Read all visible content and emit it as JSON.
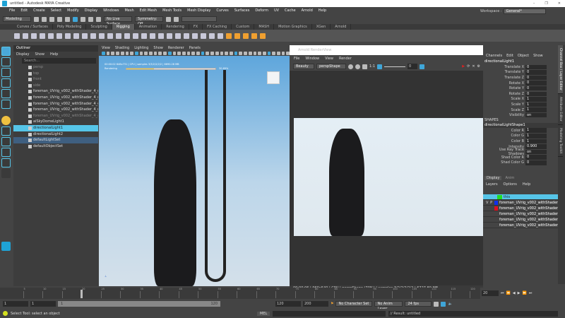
{
  "window": {
    "title": "untitled - Autodesk MAYA Creative",
    "controls": [
      "–",
      "❐",
      "✕"
    ]
  },
  "menubar": [
    "File",
    "Edit",
    "Create",
    "Select",
    "Modify",
    "Display",
    "Windows",
    "Mesh",
    "Edit Mesh",
    "Mesh Tools",
    "Mesh Display",
    "Curves",
    "Surfaces",
    "Deform",
    "UV",
    "Cache",
    "Arnold",
    "Help"
  ],
  "statusline": {
    "mode": "Modeling",
    "live_surface": "No Live Surface",
    "symmetry": "Symmetry: Off",
    "workspace_label": "Workspace :",
    "workspace": "General*"
  },
  "shelf": {
    "tabs": [
      "Curves / Surfaces",
      "Poly Modeling",
      "Sculpting",
      "Rigging",
      "Animation",
      "Rendering",
      "FX",
      "FX Caching",
      "Custom",
      "MASH",
      "Motion Graphics",
      "XGen",
      "Arnold"
    ],
    "active": "Rigging"
  },
  "outliner": {
    "title": "Outliner",
    "menu": [
      "Display",
      "Show",
      "Help"
    ],
    "search_placeholder": "Search...",
    "items": [
      {
        "label": "persp",
        "state": "dim"
      },
      {
        "label": "top",
        "state": "dim"
      },
      {
        "label": "front",
        "state": "dim"
      },
      {
        "label": "side",
        "state": "dim"
      },
      {
        "label": "foreman_UVrig_v002_withShader_4_mainGrp",
        "state": ""
      },
      {
        "label": "foreman_UVrig_v002_withShader_4_mdl",
        "state": ""
      },
      {
        "label": "foreman_UVrig_v002_withShader_4_ctrl",
        "state": ""
      },
      {
        "label": "foreman_UVrig_v002_withShader_4_rig",
        "state": ""
      },
      {
        "label": "foreman_UVrig_v002_withShader_4_aiSkyDomeLight",
        "state": "dim"
      },
      {
        "label": "aiSkyDomeLight1",
        "state": ""
      },
      {
        "label": "directionalLight1",
        "state": "sel"
      },
      {
        "label": "directionalLight2",
        "state": ""
      },
      {
        "label": "defaultLightSet",
        "state": "set"
      },
      {
        "label": "defaultObjectSet",
        "state": ""
      }
    ]
  },
  "viewport": {
    "menu": [
      "View",
      "Shading",
      "Lighting",
      "Show",
      "Renderer",
      "Panels"
    ],
    "render_info": "00:00:02 646x731 | CPU | samples 3/3/2/2/2/2 | 6690.28 MB",
    "progress_label": "Rendering",
    "progress_text": "30.69%",
    "progress": 0.3069
  },
  "renderview": {
    "title": "Arnold RenderView",
    "menu": [
      "File",
      "Window",
      "View",
      "Render"
    ],
    "aov": "Beauty",
    "camera": "perspShape",
    "ratio": "1:1",
    "exposure": "0",
    "status": "00:00:06 | 960x540 | CPU | perspShape (70%) | samples 3/2/2/2/2/2 | 6727.89 MB"
  },
  "channelbox": {
    "menu": [
      "Channels",
      "Edit",
      "Object",
      "Show"
    ],
    "node": "directionalLight1",
    "channels": [
      [
        "Translate X",
        "0"
      ],
      [
        "Translate Y",
        "0"
      ],
      [
        "Translate Z",
        "0"
      ],
      [
        "Rotate X",
        "0"
      ],
      [
        "Rotate Y",
        "0"
      ],
      [
        "Rotate Z",
        "0"
      ],
      [
        "Scale X",
        "1"
      ],
      [
        "Scale Y",
        "1"
      ],
      [
        "Scale Z",
        "1"
      ],
      [
        "Visibility",
        "on"
      ]
    ],
    "shapes_label": "SHAPES",
    "shape_node": "directionalLightShape1",
    "shape_channels": [
      [
        "Color R",
        "1"
      ],
      [
        "Color G",
        "1"
      ],
      [
        "Color B",
        "1"
      ],
      [
        "Intensity",
        "0.900"
      ],
      [
        "Use Ray Trace Shadows",
        "on"
      ],
      [
        "Shad Color R",
        "0"
      ],
      [
        "Shad Color G",
        "0"
      ]
    ]
  },
  "sidetabs": [
    "Channel Box / Layer Editor",
    "Attribute Editor",
    "Modeling Toolkit"
  ],
  "layers": {
    "tabs": [
      "Display",
      "Anim"
    ],
    "menu": [
      "Layers",
      "Options",
      "Help"
    ],
    "items": [
      {
        "v": "",
        "p": "",
        "color": "#22dd22",
        "label": "this"
      },
      {
        "v": "V",
        "p": "P",
        "color": "#1030ee",
        "label": "foreman_UVrig_v002_withShader"
      },
      {
        "v": "",
        "p": "",
        "color": "#e01020",
        "label": "foreman_UVrig_v002_withShader"
      },
      {
        "v": "",
        "p": "",
        "color": "",
        "label": "foreman_UVrig_v002_withShader"
      },
      {
        "v": "",
        "p": "",
        "color": "",
        "label": "foreman_UVrig_v002_withShader"
      },
      {
        "v": "",
        "p": "",
        "color": "",
        "label": "foreman_UVrig_v002_withShader"
      }
    ]
  },
  "timeline": {
    "ticks": [
      "5",
      "10",
      "15",
      "20",
      "25",
      "30",
      "35",
      "40",
      "45",
      "50",
      "55",
      "60",
      "65",
      "70",
      "75",
      "80",
      "85",
      "90",
      "95",
      "100",
      "105",
      "110",
      "115",
      "120"
    ],
    "current_frame": "20",
    "current": 20,
    "end": 120
  },
  "range": {
    "start": "1",
    "start2": "1",
    "range_start": "1",
    "range_end": "120",
    "end": "120",
    "end2": "200",
    "character_set": "No Character Set",
    "anim_layer": "No Anim Layer",
    "fps": "24 fps"
  },
  "cmdline": {
    "help": "Select Tool: select an object",
    "lang": "MEL",
    "result": "// Result: untitled"
  }
}
